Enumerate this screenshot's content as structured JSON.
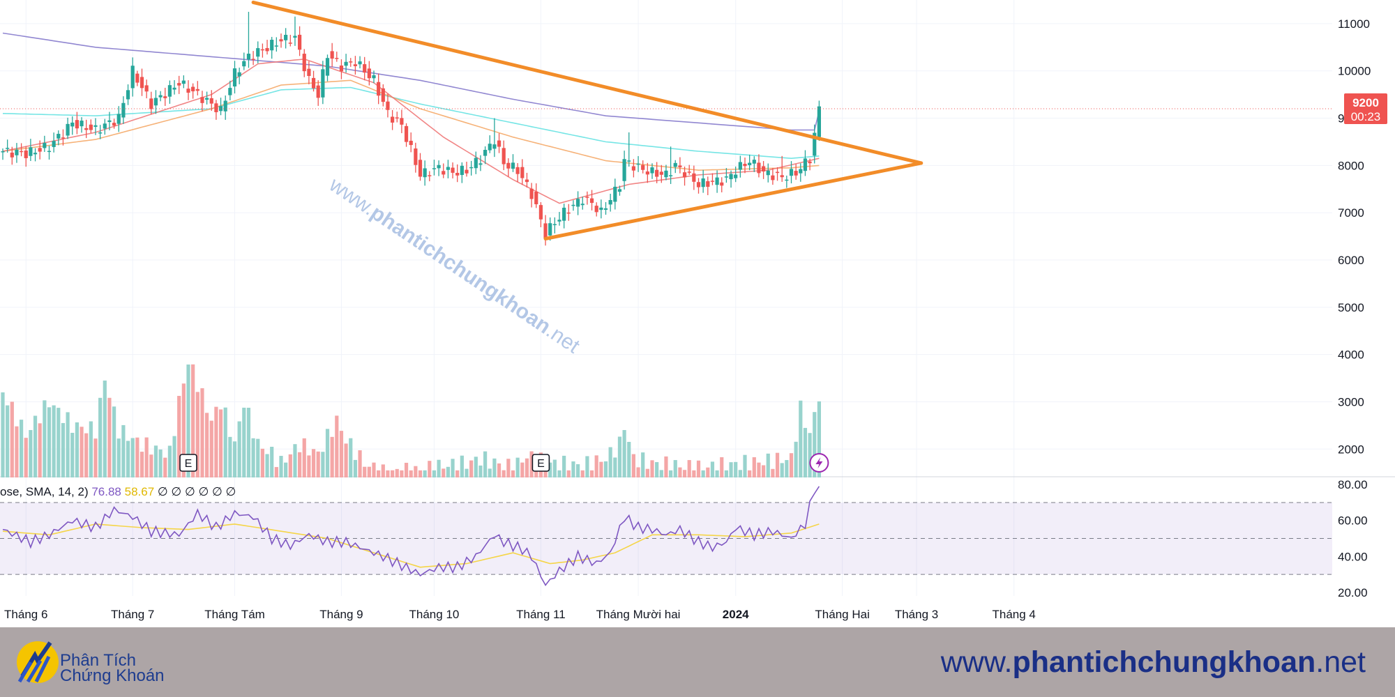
{
  "chart_data": {
    "type": "candlestick",
    "price_axis": {
      "range": [
        1400,
        11500
      ],
      "ticks": [
        11000,
        10000,
        9000,
        8000,
        7000,
        6000,
        5000,
        4000,
        3000,
        2000
      ]
    },
    "last_price": {
      "value": "9200",
      "countdown": "00:23",
      "color": "#ef5350"
    },
    "x_labels": [
      "Tháng 6",
      "Tháng 7",
      "Tháng Tám",
      "Tháng 9",
      "Tháng 10",
      "Tháng 11",
      "Tháng Mười hai",
      "2024",
      "Tháng Hai",
      "Tháng 3",
      "Tháng 4"
    ],
    "x_label_bars": [
      5,
      28,
      50,
      73,
      93,
      116,
      137,
      158,
      181,
      197,
      218
    ],
    "candle_color_up": "#26a69a",
    "candle_color_down": "#ef5350",
    "key_prices": [
      [
        0,
        8300
      ],
      [
        5,
        8250
      ],
      [
        10,
        8400
      ],
      [
        15,
        8900
      ],
      [
        20,
        8750
      ],
      [
        25,
        9000
      ],
      [
        28,
        10000
      ],
      [
        32,
        9300
      ],
      [
        38,
        9750
      ],
      [
        42,
        9500
      ],
      [
        47,
        9150
      ],
      [
        50,
        9950
      ],
      [
        53,
        10300
      ],
      [
        57,
        10500
      ],
      [
        60,
        10650
      ],
      [
        63,
        10700
      ],
      [
        66,
        9800
      ],
      [
        68,
        9500
      ],
      [
        70,
        10350
      ],
      [
        73,
        10100
      ],
      [
        76,
        10200
      ],
      [
        80,
        9800
      ],
      [
        83,
        9100
      ],
      [
        86,
        8850
      ],
      [
        90,
        7800
      ],
      [
        94,
        7950
      ],
      [
        97,
        7850
      ],
      [
        100,
        7900
      ],
      [
        103,
        8150
      ],
      [
        106,
        8550
      ],
      [
        108,
        8050
      ],
      [
        111,
        7900
      ],
      [
        114,
        7400
      ],
      [
        117,
        6550
      ],
      [
        119,
        6800
      ],
      [
        121,
        7000
      ],
      [
        123,
        7150
      ],
      [
        125,
        7300
      ],
      [
        127,
        7200
      ],
      [
        129,
        7000
      ],
      [
        131,
        7300
      ],
      [
        133,
        7600
      ],
      [
        134,
        8100
      ],
      [
        137,
        7950
      ],
      [
        140,
        7850
      ],
      [
        143,
        7800
      ],
      [
        145,
        8000
      ],
      [
        147,
        7850
      ],
      [
        150,
        7600
      ],
      [
        153,
        7650
      ],
      [
        156,
        7700
      ],
      [
        158,
        7900
      ],
      [
        161,
        8100
      ],
      [
        164,
        7850
      ],
      [
        168,
        7750
      ],
      [
        171,
        7850
      ],
      [
        174,
        8150
      ],
      [
        175,
        8650
      ],
      [
        176,
        9200
      ]
    ],
    "spikes": [
      [
        53,
        11250
      ],
      [
        63,
        11150
      ],
      [
        106,
        9000
      ],
      [
        135,
        8700
      ],
      [
        144,
        8400
      ],
      [
        168,
        8200
      ]
    ],
    "moving_averages": [
      {
        "color": "#7e72c9",
        "points": [
          [
            0,
            10800
          ],
          [
            20,
            10500
          ],
          [
            45,
            10300
          ],
          [
            70,
            10100
          ],
          [
            90,
            9800
          ],
          [
            110,
            9400
          ],
          [
            130,
            9050
          ],
          [
            150,
            8900
          ],
          [
            170,
            8750
          ],
          [
            175,
            8750
          ],
          [
            176,
            9150
          ]
        ]
      },
      {
        "color": "#5de0e0",
        "points": [
          [
            0,
            9100
          ],
          [
            20,
            9050
          ],
          [
            45,
            9200
          ],
          [
            60,
            9600
          ],
          [
            75,
            9650
          ],
          [
            90,
            9300
          ],
          [
            110,
            8900
          ],
          [
            130,
            8500
          ],
          [
            150,
            8300
          ],
          [
            170,
            8150
          ],
          [
            176,
            8200
          ]
        ]
      },
      {
        "color": "#f4a460",
        "points": [
          [
            0,
            8300
          ],
          [
            20,
            8550
          ],
          [
            45,
            9200
          ],
          [
            60,
            9700
          ],
          [
            75,
            9800
          ],
          [
            90,
            9200
          ],
          [
            110,
            8600
          ],
          [
            130,
            8100
          ],
          [
            150,
            7900
          ],
          [
            170,
            7950
          ],
          [
            176,
            8000
          ]
        ]
      },
      {
        "color": "#ee7070",
        "points": [
          [
            0,
            8300
          ],
          [
            20,
            8700
          ],
          [
            45,
            9500
          ],
          [
            55,
            10150
          ],
          [
            65,
            10250
          ],
          [
            80,
            9750
          ],
          [
            95,
            8600
          ],
          [
            110,
            7700
          ],
          [
            120,
            7200
          ],
          [
            135,
            7600
          ],
          [
            150,
            7800
          ],
          [
            165,
            7900
          ],
          [
            176,
            8150
          ]
        ]
      }
    ],
    "trendlines": [
      {
        "color": "#f28c28",
        "from": [
          54,
          11450
        ],
        "to": [
          198,
          8050
        ]
      },
      {
        "color": "#f28c28",
        "from": [
          117,
          6450
        ],
        "to": [
          198,
          8050
        ]
      }
    ],
    "volume_key": [
      [
        0,
        3200
      ],
      [
        5,
        2300
      ],
      [
        10,
        3000
      ],
      [
        15,
        2500
      ],
      [
        20,
        2400
      ],
      [
        22,
        3500
      ],
      [
        25,
        2400
      ],
      [
        30,
        2100
      ],
      [
        36,
        1900
      ],
      [
        38,
        3000
      ],
      [
        40,
        3850
      ],
      [
        41,
        3650
      ],
      [
        45,
        2600
      ],
      [
        47,
        3000
      ],
      [
        50,
        2100
      ],
      [
        52,
        3000
      ],
      [
        55,
        2100
      ],
      [
        58,
        1900
      ],
      [
        60,
        1700
      ],
      [
        64,
        2100
      ],
      [
        68,
        1900
      ],
      [
        72,
        2600
      ],
      [
        74,
        2200
      ],
      [
        78,
        1700
      ],
      [
        82,
        1500
      ],
      [
        90,
        1550
      ],
      [
        95,
        1650
      ],
      [
        100,
        1700
      ],
      [
        103,
        1800
      ],
      [
        110,
        1600
      ],
      [
        113,
        1850
      ],
      [
        118,
        1700
      ],
      [
        125,
        1650
      ],
      [
        130,
        1800
      ],
      [
        133,
        2100
      ],
      [
        134,
        2500
      ],
      [
        136,
        1800
      ],
      [
        140,
        1700
      ],
      [
        145,
        1650
      ],
      [
        150,
        1600
      ],
      [
        155,
        1650
      ],
      [
        160,
        1700
      ],
      [
        165,
        1750
      ],
      [
        170,
        1800
      ],
      [
        172,
        2850
      ],
      [
        174,
        2300
      ],
      [
        176,
        3150
      ]
    ],
    "earnings_markers": [
      {
        "bar": 40,
        "label": "E"
      },
      {
        "bar": 116,
        "label": "E"
      }
    ],
    "rsi": {
      "legend_prefix": "ose, SMA, 14, 2)",
      "value": "76.88",
      "sma_value": "58.67",
      "placeholders": "∅ ∅ ∅ ∅ ∅ ∅",
      "range": [
        18,
        82
      ],
      "ticks": [
        "80.00",
        "60.00",
        "40.00",
        "20.00"
      ],
      "tick_values": [
        80,
        60,
        40,
        20
      ],
      "band": [
        30,
        70
      ],
      "line_color": "#7e57c2",
      "sma_color": "#f5d547",
      "points": [
        [
          0,
          55
        ],
        [
          6,
          48
        ],
        [
          10,
          52
        ],
        [
          15,
          60
        ],
        [
          20,
          56
        ],
        [
          24,
          66
        ],
        [
          28,
          62
        ],
        [
          32,
          54
        ],
        [
          38,
          52
        ],
        [
          42,
          64
        ],
        [
          46,
          56
        ],
        [
          50,
          64
        ],
        [
          54,
          62
        ],
        [
          58,
          50
        ],
        [
          62,
          46
        ],
        [
          66,
          52
        ],
        [
          70,
          48
        ],
        [
          74,
          48
        ],
        [
          78,
          44
        ],
        [
          82,
          40
        ],
        [
          86,
          35
        ],
        [
          90,
          30
        ],
        [
          94,
          34
        ],
        [
          98,
          34
        ],
        [
          102,
          40
        ],
        [
          106,
          52
        ],
        [
          108,
          48
        ],
        [
          112,
          44
        ],
        [
          114,
          40
        ],
        [
          117,
          24
        ],
        [
          120,
          32
        ],
        [
          124,
          40
        ],
        [
          128,
          36
        ],
        [
          131,
          42
        ],
        [
          134,
          62
        ],
        [
          137,
          56
        ],
        [
          140,
          55
        ],
        [
          143,
          52
        ],
        [
          146,
          55
        ],
        [
          150,
          48
        ],
        [
          153,
          45
        ],
        [
          156,
          48
        ],
        [
          158,
          56
        ],
        [
          162,
          52
        ],
        [
          166,
          54
        ],
        [
          170,
          50
        ],
        [
          173,
          58
        ],
        [
          175,
          78
        ],
        [
          176,
          76
        ]
      ],
      "sma_points": [
        [
          0,
          54
        ],
        [
          10,
          52
        ],
        [
          20,
          58
        ],
        [
          30,
          56
        ],
        [
          40,
          55
        ],
        [
          50,
          58
        ],
        [
          60,
          54
        ],
        [
          70,
          50
        ],
        [
          80,
          42
        ],
        [
          90,
          34
        ],
        [
          100,
          36
        ],
        [
          110,
          42
        ],
        [
          118,
          36
        ],
        [
          125,
          38
        ],
        [
          132,
          42
        ],
        [
          140,
          52
        ],
        [
          150,
          52
        ],
        [
          160,
          51
        ],
        [
          170,
          53
        ],
        [
          176,
          58
        ]
      ]
    }
  },
  "watermark": {
    "prefix": "www.",
    "brand": "phantichchungkhoan",
    "suffix": ".net"
  },
  "footer": {
    "logo_line1": "Phân Tích",
    "logo_line2": "Chứng Khoán",
    "site_prefix": "www.",
    "site_brand": "phantichchungkhoan",
    "site_suffix": ".net"
  }
}
